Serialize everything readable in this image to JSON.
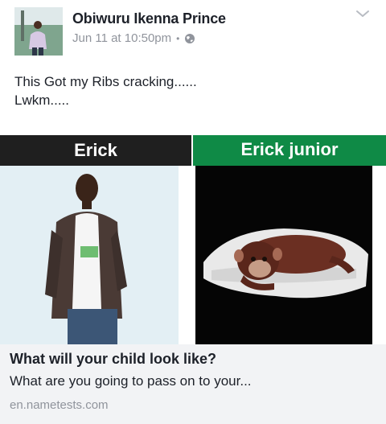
{
  "post": {
    "author": "Obiwuru Ikenna Prince",
    "timestamp": "Jun 11 at 10:50pm",
    "separator": "•",
    "privacy_icon": "globe-icon",
    "menu_icon": "chevron-down-icon",
    "text_line1": "This Got my Ribs cracking......",
    "text_line2": "Lwkm....."
  },
  "preview": {
    "left_label": "Erick",
    "right_label": "Erick junior",
    "title": "What will your child look like?",
    "description": "What are you going to pass on to your...",
    "domain": "en.nametests.com",
    "colors": {
      "left_label_bg": "#1f1f1f",
      "right_label_bg": "#0f8a46"
    }
  }
}
